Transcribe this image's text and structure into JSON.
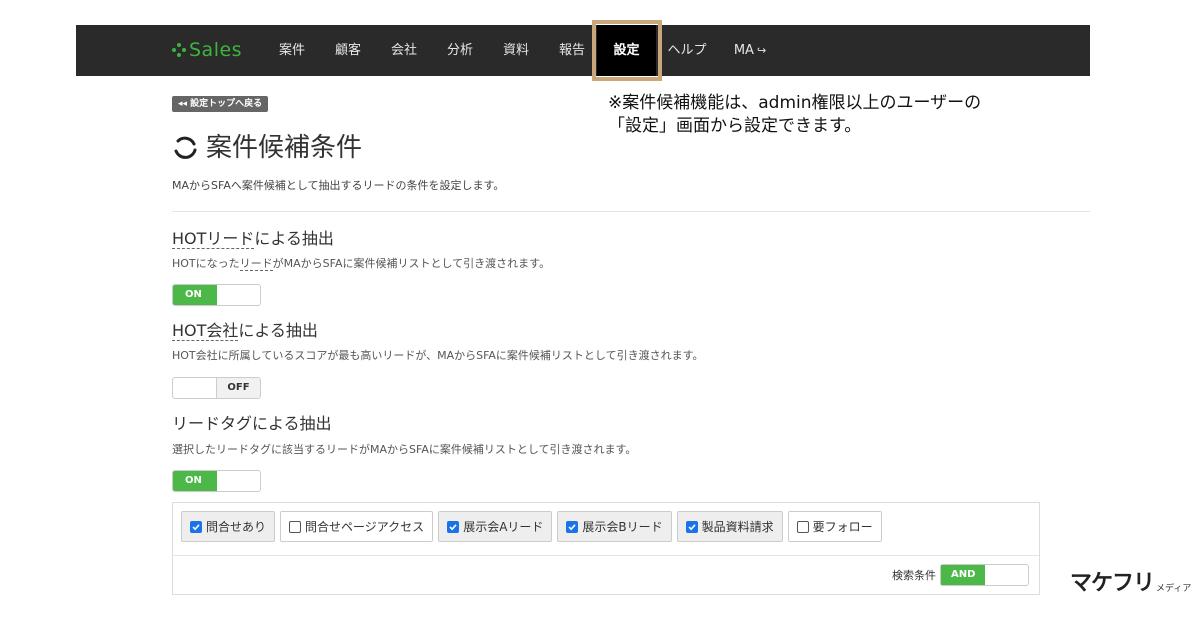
{
  "nav": {
    "brand": "Sales",
    "items": [
      {
        "label": "案件"
      },
      {
        "label": "顧客"
      },
      {
        "label": "会社"
      },
      {
        "label": "分析"
      },
      {
        "label": "資料"
      },
      {
        "label": "報告"
      },
      {
        "label": "設定",
        "active": true
      },
      {
        "label": "ヘルプ"
      },
      {
        "label": "MA"
      }
    ]
  },
  "back_link": "◂◂ 設定トップへ戻る",
  "note": {
    "line1": "※案件候補機能は、admin権限以上のユーザーの",
    "line2": "「設定」画面から設定できます。"
  },
  "page": {
    "title": "案件候補条件",
    "description": "MAからSFAへ案件候補として抽出するリードの条件を設定します。"
  },
  "sections": {
    "hot_lead": {
      "title_pre": "HOTリード",
      "title_post": "による抽出",
      "desc_pre": "HOTになった",
      "desc_link": "リード",
      "desc_post": "がMAからSFAに案件候補リストとして引き渡されます。",
      "toggle": "ON"
    },
    "hot_company": {
      "title_pre": "HOT会社",
      "title_post": "による抽出",
      "desc": "HOT会社に所属しているスコアが最も高いリードが、MAからSFAに案件候補リストとして引き渡されます。",
      "toggle": "OFF"
    },
    "lead_tag": {
      "title": "リードタグによる抽出",
      "desc": "選択したリードタグに該当するリードがMAからSFAに案件候補リストとして引き渡されます。",
      "toggle": "ON"
    }
  },
  "tags": [
    {
      "label": "問合せあり",
      "checked": true
    },
    {
      "label": "問合せページアクセス",
      "checked": false
    },
    {
      "label": "展示会Aリード",
      "checked": true
    },
    {
      "label": "展示会Bリード",
      "checked": true
    },
    {
      "label": "製品資料請求",
      "checked": true
    },
    {
      "label": "要フォロー",
      "checked": false
    }
  ],
  "search": {
    "label": "検索条件",
    "value": "AND"
  },
  "watermark": {
    "main": "マケフリ",
    "sub": "メディア"
  },
  "colors": {
    "nav_bg": "#2a2a2a",
    "brand_green": "#3db43d",
    "toggle_on": "#4cb848",
    "highlight_border": "#c9a77a",
    "checkbox_checked": "#1a73e8"
  }
}
